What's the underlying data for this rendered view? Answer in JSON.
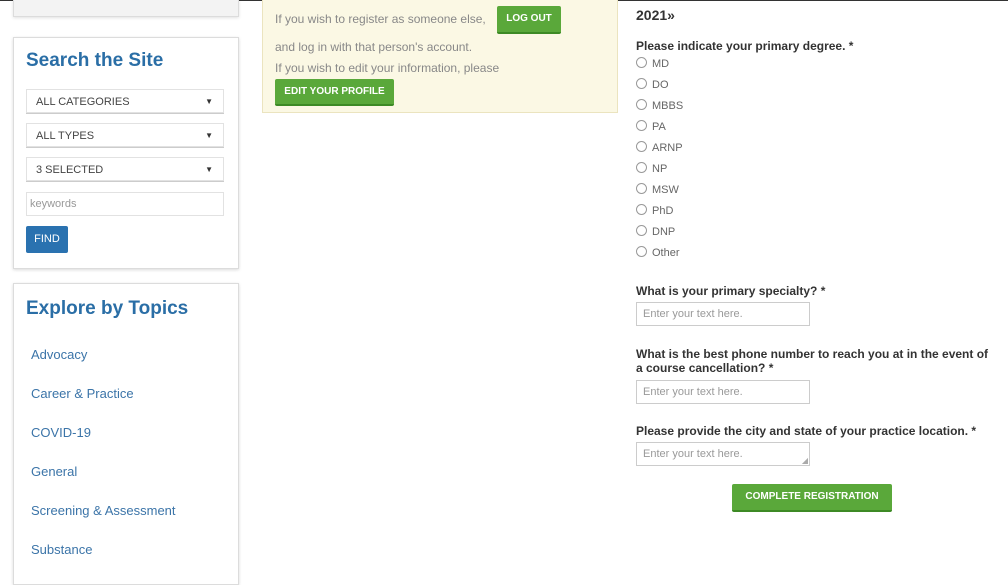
{
  "sidebar": {
    "search": {
      "title": "Search the Site",
      "category_select": "ALL CATEGORIES",
      "type_select": "ALL TYPES",
      "selected_select": "3 SELECTED",
      "keywords_placeholder": "keywords",
      "find_label": "FIND"
    },
    "topics": {
      "title": "Explore by Topics",
      "items": [
        "Advocacy",
        "Career & Practice",
        "COVID-19",
        "General",
        "Screening & Assessment",
        "Substance"
      ]
    }
  },
  "notice": {
    "line1": "If you wish to register as someone else,",
    "logout_label": "LOG OUT",
    "line2": "and log in with that person's account.",
    "line3": "If you wish to edit your information, please",
    "edit_profile_label": "EDIT YOUR PROFILE"
  },
  "form": {
    "heading": "2021»",
    "degree_question": "Please indicate your primary degree. *",
    "degree_options": [
      "MD",
      "DO",
      "MBBS",
      "PA",
      "ARNP",
      "NP",
      "MSW",
      "PhD",
      "DNP",
      "Other"
    ],
    "specialty_question": "What is your primary specialty? *",
    "specialty_placeholder": "Enter your text here.",
    "phone_question": "What is the best phone number to reach you at in the event of a course cancellation? *",
    "phone_placeholder": "Enter your text here.",
    "location_question": "Please provide the city and state of your practice location. *",
    "location_placeholder": "Enter your text here.",
    "submit_label": "COMPLETE REGISTRATION"
  },
  "colors": {
    "link_blue": "#2a6ea6",
    "find_button": "#2a72b0",
    "green_button": "#5aa83a",
    "notice_bg": "#fbf8e4"
  }
}
